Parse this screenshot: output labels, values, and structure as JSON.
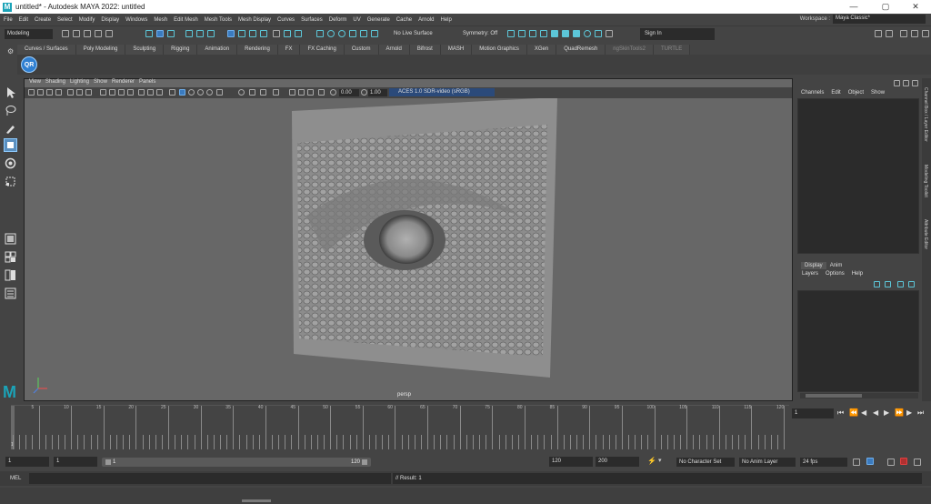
{
  "app": {
    "title": "untitled* - Autodesk MAYA 2022: untitled",
    "logo_letter": "M",
    "window_controls": [
      "—",
      "▢",
      "✕"
    ]
  },
  "menubar": [
    "File",
    "Edit",
    "Create",
    "Select",
    "Modify",
    "Display",
    "Windows",
    "Mesh",
    "Edit Mesh",
    "Mesh Tools",
    "Mesh Display",
    "Curves",
    "Surfaces",
    "Deform",
    "UV",
    "Generate",
    "Cache",
    "Arnold",
    "Help"
  ],
  "workspace": {
    "label": "Workspace :",
    "value": "Maya Classic*"
  },
  "statusline": {
    "mode": "Modeling",
    "live_surface": "No Live Surface",
    "symmetry": "Symmetry: Off",
    "sign_in": "Sign In"
  },
  "shelf": {
    "tabs": [
      "Curves / Surfaces",
      "Poly Modeling",
      "Sculpting",
      "Rigging",
      "Animation",
      "Rendering",
      "FX",
      "FX Caching",
      "Custom",
      "Arnold",
      "Bifrost",
      "MASH",
      "Motion Graphics",
      "XGen",
      "QuadRemesh",
      "ngSkinTools2",
      "TURTLE"
    ],
    "qr_label": "QR"
  },
  "viewport": {
    "menus": [
      "View",
      "Shading",
      "Lighting",
      "Show",
      "Renderer",
      "Panels"
    ],
    "exposure": "0.00",
    "gamma": "1.00",
    "color_space": "ACES 1.0 SDR-video (sRGB)",
    "camera_label": "persp"
  },
  "channel_box": {
    "menus": [
      "Channels",
      "Edit",
      "Object",
      "Show"
    ],
    "tabs": [
      "Display",
      "Anim"
    ],
    "layer_menus": [
      "Layers",
      "Options",
      "Help"
    ]
  },
  "side_tabs": [
    "Channel Box / Layer Editor",
    "Modeling Toolkit",
    "Attribute Editor"
  ],
  "timeline": {
    "ticks": [
      5,
      10,
      15,
      20,
      25,
      30,
      35,
      40,
      45,
      50,
      55,
      60,
      65,
      70,
      75,
      80,
      85,
      90,
      95,
      100,
      105,
      110,
      115,
      120
    ],
    "start_marker": "1",
    "current_frame": "1"
  },
  "range": {
    "start": "1",
    "playback_start": "1",
    "slider_left": "1",
    "slider_right": "120",
    "playback_end": "120",
    "end": "200",
    "character_set": "No Character Set",
    "anim_layer": "No Anim Layer",
    "fps": "24 fps"
  },
  "command": {
    "lang": "MEL",
    "result": "// Result: 1"
  }
}
